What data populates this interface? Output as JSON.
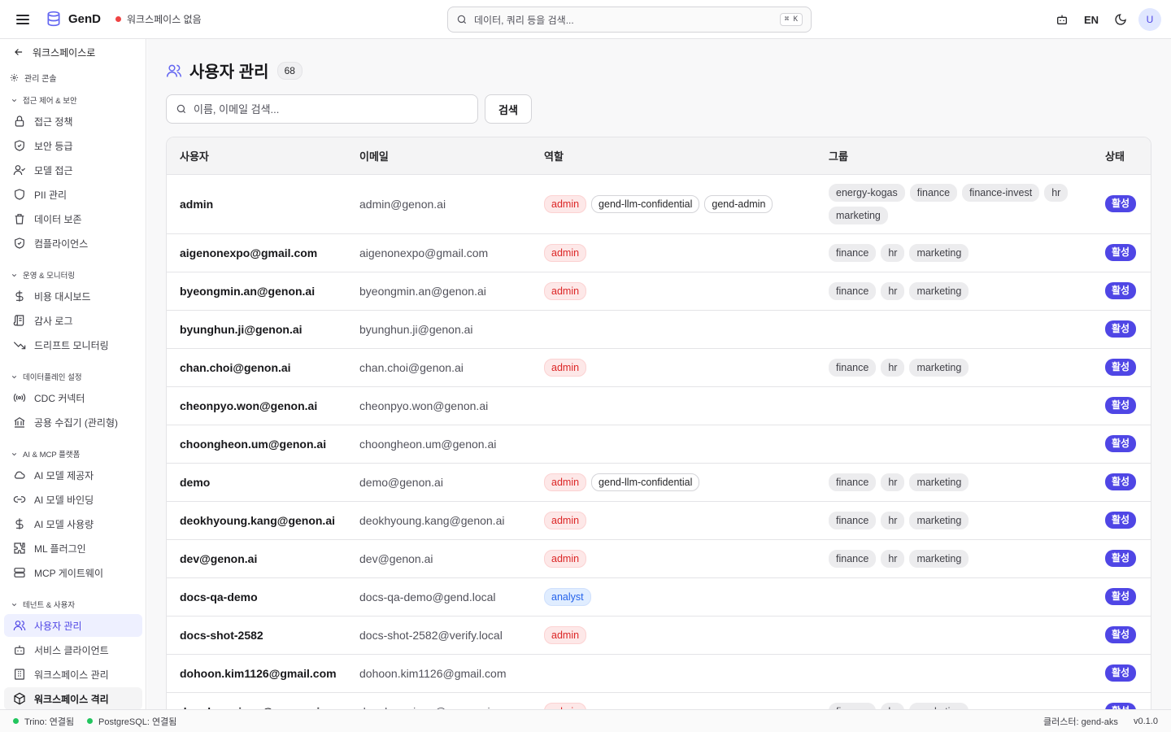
{
  "app": {
    "name": "GenD",
    "workspace_status": "워크스페이스 없음",
    "search_placeholder": "데이터, 쿼리 등을 검색...",
    "search_shortcut": "⌘ K",
    "lang": "EN",
    "avatar_initial": "U",
    "colors": {
      "accent": "#4f46e5",
      "danger": "#ef4444",
      "success": "#22c55e"
    }
  },
  "sidebar": {
    "back_label": "워크스페이스로",
    "console_label": "관리 콘솔",
    "sections": [
      {
        "title": "접근 제어 & 보안",
        "items": [
          {
            "label": "접근 정책",
            "icon": "lock-icon"
          },
          {
            "label": "보안 등급",
            "icon": "shield-check-icon"
          },
          {
            "label": "모델 접근",
            "icon": "user-check-icon"
          },
          {
            "label": "PII 관리",
            "icon": "shield-icon"
          },
          {
            "label": "데이터 보존",
            "icon": "trash-icon"
          },
          {
            "label": "컴플라이언스",
            "icon": "shield-check-icon"
          }
        ]
      },
      {
        "title": "운영 & 모니터링",
        "items": [
          {
            "label": "비용 대시보드",
            "icon": "dollar-icon"
          },
          {
            "label": "감사 로그",
            "icon": "scroll-icon"
          },
          {
            "label": "드리프트 모니터링",
            "icon": "trend-down-icon"
          }
        ]
      },
      {
        "title": "데이터플레인 설정",
        "items": [
          {
            "label": "CDC 커넥터",
            "icon": "radio-icon"
          },
          {
            "label": "공용 수집기 (관리형)",
            "icon": "bank-icon"
          }
        ]
      },
      {
        "title": "AI & MCP 플랫폼",
        "items": [
          {
            "label": "AI 모델 제공자",
            "icon": "cloud-icon"
          },
          {
            "label": "AI 모델 바인딩",
            "icon": "link-icon"
          },
          {
            "label": "AI 모델 사용량",
            "icon": "dollar-icon"
          },
          {
            "label": "ML 플러그인",
            "icon": "puzzle-icon"
          },
          {
            "label": "MCP 게이트웨이",
            "icon": "server-icon"
          }
        ]
      },
      {
        "title": "테넌트 & 사용자",
        "items": [
          {
            "label": "사용자 관리",
            "icon": "users-icon"
          },
          {
            "label": "서비스 클라이언트",
            "icon": "bot-icon"
          },
          {
            "label": "워크스페이스 관리",
            "icon": "building-icon"
          },
          {
            "label": "워크스페이스 격리",
            "icon": "box-icon"
          }
        ]
      }
    ]
  },
  "main": {
    "title": "사용자 관리",
    "count": "68",
    "search_placeholder": "이름, 이메일 검색...",
    "search_button": "검색",
    "columns": [
      "사용자",
      "이메일",
      "역할",
      "그룹",
      "상태"
    ],
    "rows": [
      {
        "user": "admin",
        "email": "admin@genon.ai",
        "roles": [
          "admin",
          "gend-llm-confidential",
          "gend-admin"
        ],
        "groups": [
          "energy-kogas",
          "finance",
          "finance-invest",
          "hr",
          "marketing"
        ],
        "status": "활성"
      },
      {
        "user": "aigenonexpo@gmail.com",
        "email": "aigenonexpo@gmail.com",
        "roles": [
          "admin"
        ],
        "groups": [
          "finance",
          "hr",
          "marketing"
        ],
        "status": "활성"
      },
      {
        "user": "byeongmin.an@genon.ai",
        "email": "byeongmin.an@genon.ai",
        "roles": [
          "admin"
        ],
        "groups": [
          "finance",
          "hr",
          "marketing"
        ],
        "status": "활성"
      },
      {
        "user": "byunghun.ji@genon.ai",
        "email": "byunghun.ji@genon.ai",
        "roles": [],
        "groups": [],
        "status": "활성"
      },
      {
        "user": "chan.choi@genon.ai",
        "email": "chan.choi@genon.ai",
        "roles": [
          "admin"
        ],
        "groups": [
          "finance",
          "hr",
          "marketing"
        ],
        "status": "활성"
      },
      {
        "user": "cheonpyo.won@genon.ai",
        "email": "cheonpyo.won@genon.ai",
        "roles": [],
        "groups": [],
        "status": "활성"
      },
      {
        "user": "choongheon.um@genon.ai",
        "email": "choongheon.um@genon.ai",
        "roles": [],
        "groups": [],
        "status": "활성"
      },
      {
        "user": "demo",
        "email": "demo@genon.ai",
        "roles": [
          "admin",
          "gend-llm-confidential"
        ],
        "groups": [
          "finance",
          "hr",
          "marketing"
        ],
        "status": "활성"
      },
      {
        "user": "deokhyoung.kang@genon.ai",
        "email": "deokhyoung.kang@genon.ai",
        "roles": [
          "admin"
        ],
        "groups": [
          "finance",
          "hr",
          "marketing"
        ],
        "status": "활성"
      },
      {
        "user": "dev@genon.ai",
        "email": "dev@genon.ai",
        "roles": [
          "admin"
        ],
        "groups": [
          "finance",
          "hr",
          "marketing"
        ],
        "status": "활성"
      },
      {
        "user": "docs-qa-demo",
        "email": "docs-qa-demo@gend.local",
        "roles": [
          "analyst"
        ],
        "groups": [],
        "status": "활성"
      },
      {
        "user": "docs-shot-2582",
        "email": "docs-shot-2582@verify.local",
        "roles": [
          "admin"
        ],
        "groups": [],
        "status": "활성"
      },
      {
        "user": "dohoon.kim1126@gmail.com",
        "email": "dohoon.kim1126@gmail.com",
        "roles": [],
        "groups": [],
        "status": "활성"
      },
      {
        "user": "donghoon.jang@genon.ai",
        "email": "donghoon.jang@genon.ai",
        "roles": [
          "admin"
        ],
        "groups": [
          "finance",
          "hr",
          "marketing"
        ],
        "status": "활성"
      }
    ]
  },
  "statusbar": {
    "trino": "Trino: 연결됨",
    "postgres": "PostgreSQL: 연결됨",
    "cluster": "클러스터: gend-aks",
    "version": "v0.1.0"
  }
}
